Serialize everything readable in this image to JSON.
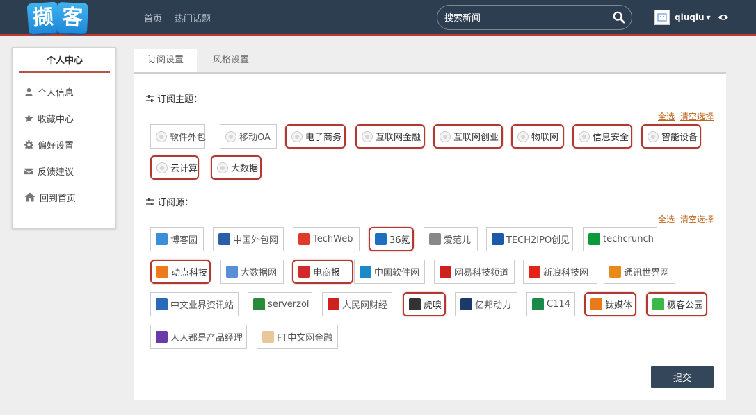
{
  "header": {
    "logo_chars": [
      "撷",
      "客"
    ],
    "nav": [
      "首页",
      "热门话题"
    ],
    "search_placeholder": "搜索新闻",
    "username": "qiuqiu",
    "colors": {
      "bar": "#2d3e50",
      "accent": "#c0392b"
    }
  },
  "sidebar": {
    "title": "个人中心",
    "items": [
      {
        "label": "个人信息",
        "icon": "user-icon"
      },
      {
        "label": "收藏中心",
        "icon": "star-icon"
      },
      {
        "label": "偏好设置",
        "icon": "gear-icon"
      },
      {
        "label": "反馈建议",
        "icon": "envelope-icon"
      },
      {
        "label": "回到首页",
        "icon": "home-icon"
      }
    ]
  },
  "tabs": {
    "active": "订阅设置",
    "inactive": "风格设置"
  },
  "topics": {
    "title": "订阅主题：",
    "select_all": "全选",
    "clear": "清空选择",
    "items": [
      {
        "label": "软件外包",
        "selected": false
      },
      {
        "label": "移动OA",
        "selected": false
      },
      {
        "label": "电子商务",
        "selected": true
      },
      {
        "label": "互联网金融",
        "selected": true
      },
      {
        "label": "互联网创业",
        "selected": true
      },
      {
        "label": "物联网",
        "selected": true
      },
      {
        "label": "信息安全",
        "selected": true
      },
      {
        "label": "智能设备",
        "selected": true
      },
      {
        "label": "云计算",
        "selected": true
      },
      {
        "label": "大数据",
        "selected": true
      }
    ]
  },
  "sources": {
    "title": "订阅源：",
    "select_all": "全选",
    "clear": "清空选择",
    "items": [
      {
        "label": "博客园",
        "selected": false,
        "icon": "cnblogs-logo-icon",
        "color": "#3a8fd6"
      },
      {
        "label": "中国外包网",
        "selected": false,
        "icon": "chinaoutsourcing-logo-icon",
        "color": "#2a5fa8"
      },
      {
        "label": "TechWeb",
        "selected": false,
        "icon": "techweb-logo-icon",
        "color": "#e03a2a"
      },
      {
        "label": "36氪",
        "selected": true,
        "icon": "36kr-logo-icon",
        "color": "#1f6fc0"
      },
      {
        "label": "爱范儿",
        "selected": false,
        "icon": "ifanr-logo-icon",
        "color": "#888888"
      },
      {
        "label": "TECH2IPO创见",
        "selected": false,
        "icon": "tech2ipo-logo-icon",
        "color": "#1b5aa6"
      },
      {
        "label": "techcrunch",
        "selected": false,
        "icon": "techcrunch-logo-icon",
        "color": "#0a9a3a"
      },
      {
        "label": "动点科技",
        "selected": true,
        "icon": "technode-logo-icon",
        "color": "#f07a1a"
      },
      {
        "label": "大数据网",
        "selected": false,
        "icon": "bigdata-logo-icon",
        "color": "#5a8fd8"
      },
      {
        "label": "电商报",
        "selected": true,
        "icon": "dsb-logo-icon",
        "color": "#d02a2a"
      },
      {
        "label": "中国软件网",
        "selected": false,
        "icon": "soft6-logo-icon",
        "color": "#1a8ac8"
      },
      {
        "label": "网易科技频道",
        "selected": false,
        "icon": "netease-logo-icon",
        "color": "#d02020"
      },
      {
        "label": "新浪科技网",
        "selected": false,
        "icon": "sina-logo-icon",
        "color": "#e2231a"
      },
      {
        "label": "通讯世界网",
        "selected": false,
        "icon": "cww-logo-icon",
        "color": "#e88a1a"
      },
      {
        "label": "中文业界资讯站",
        "selected": false,
        "icon": "cnbeta-logo-icon",
        "color": "#2a6ab8"
      },
      {
        "label": "serverzol",
        "selected": false,
        "icon": "serverzol-logo-icon",
        "color": "#2a8a3a"
      },
      {
        "label": "人民网财经",
        "selected": false,
        "icon": "people-logo-icon",
        "color": "#d02020"
      },
      {
        "label": "虎嗅",
        "selected": true,
        "icon": "huxiu-logo-icon",
        "color": "#333333"
      },
      {
        "label": "亿邦动力",
        "selected": false,
        "icon": "ebrun-logo-icon",
        "color": "#1a3a6a"
      },
      {
        "label": "C114",
        "selected": false,
        "icon": "c114-logo-icon",
        "color": "#1a8a4a"
      },
      {
        "label": "钛媒体",
        "selected": true,
        "icon": "tmtpost-logo-icon",
        "color": "#e87a1a"
      },
      {
        "label": "极客公园",
        "selected": true,
        "icon": "geekpark-logo-icon",
        "color": "#3ab84a"
      },
      {
        "label": "人人都是产品经理",
        "selected": false,
        "icon": "woshipm-logo-icon",
        "color": "#6a3aa8"
      },
      {
        "label": "FT中文网金融",
        "selected": false,
        "icon": "ftchinese-logo-icon",
        "color": "#e8c89a"
      }
    ]
  },
  "submit_label": "提交"
}
